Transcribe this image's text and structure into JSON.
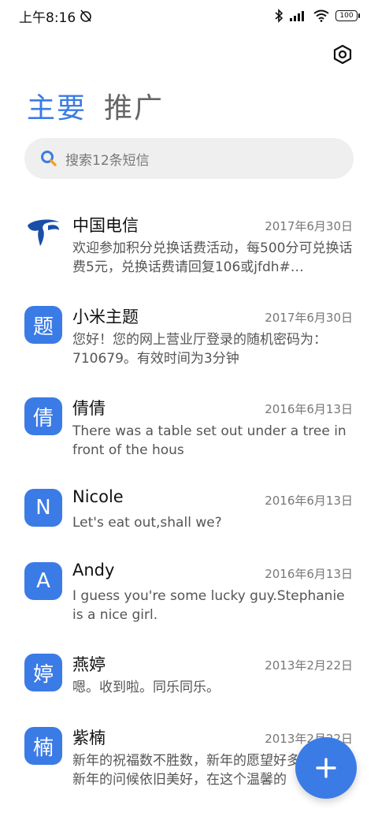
{
  "status_bar": {
    "time": "上午8:16",
    "battery": "100"
  },
  "tabs": [
    {
      "label": "主要"
    },
    {
      "label": "推广"
    }
  ],
  "search": {
    "placeholder": "搜索12条短信"
  },
  "conversations": [
    {
      "avatar": "",
      "name": "中国电信",
      "date": "2017年6月30日",
      "preview": "欢迎参加积分兑换话费活动，每500分可兑换话费5元，兑换话费请回复106或jfdh#…"
    },
    {
      "avatar": "题",
      "name": "小米主题",
      "date": "2017年6月30日",
      "preview": "您好！您的网上营业厅登录的随机密码为：710679。有效时间为3分钟"
    },
    {
      "avatar": "倩",
      "name": "倩倩",
      "date": "2016年6月13日",
      "preview": "There was a table set out under a tree in front of the hous"
    },
    {
      "avatar": "N",
      "name": "Nicole",
      "date": "2016年6月13日",
      "preview": "Let's eat out,shall we?"
    },
    {
      "avatar": "A",
      "name": "Andy",
      "date": "2016年6月13日",
      "preview": "I guess you're some lucky guy.Stephanie is a nice girl."
    },
    {
      "avatar": "婷",
      "name": "燕婷",
      "date": "2013年2月22日",
      "preview": "嗯。收到啦。同乐同乐。"
    },
    {
      "avatar": "楠",
      "name": "紫楠",
      "date": "2013年2月22日",
      "preview": "新年的祝福数不胜数，新年的愿望好多好多，新年的问候依旧美好，在这个温馨的"
    }
  ],
  "colors": {
    "accent": "#3b7be6"
  }
}
